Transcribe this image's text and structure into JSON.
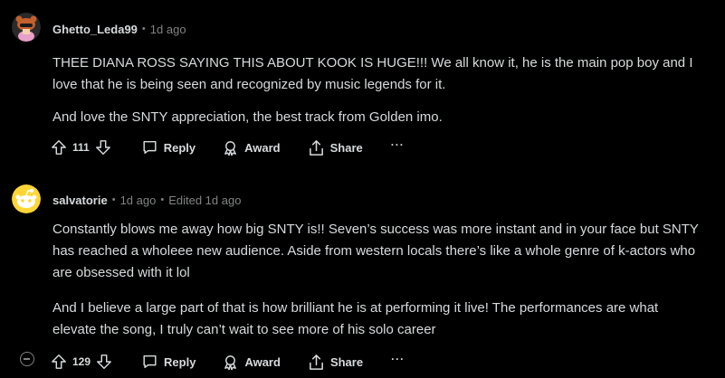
{
  "comments": [
    {
      "author": "Ghetto_Leda99",
      "separator": "•",
      "time": "1d ago",
      "paragraphs": [
        "THEE DIANA ROSS SAYING THIS ABOUT KOOK IS HUGE!!! We all know it, he is the main pop boy and I love that he is being seen and recognized by music legends for it.",
        "And love the SNTY appreciation, the best track from Golden imo."
      ],
      "score": "111",
      "actions": {
        "reply": "Reply",
        "award": "Award",
        "share": "Share",
        "more": "···"
      }
    },
    {
      "author": "salvatorie",
      "separator": "•",
      "time": "1d ago",
      "edited_separator": "•",
      "edited": "Edited 1d ago",
      "paragraphs": [
        "Constantly blows me away how big SNTY is!! Seven’s success was more instant and in your face but SNTY has reached a wholeee new audience. Aside from western locals there’s like a whole genre of k-actors who are obsessed with it lol",
        "And I believe a large part of that is how brilliant he is at performing it live! The performances are what elevate the song, I truly can’t wait to see more of his solo career"
      ],
      "score": "129",
      "actions": {
        "reply": "Reply",
        "award": "Award",
        "share": "Share",
        "more": "···"
      }
    }
  ],
  "colors": {
    "background": "#000000",
    "text": "#d7dadc",
    "meta": "#818384",
    "avatar1": "#c4602b",
    "avatar2": "#ffd635"
  },
  "icons": {
    "upvote": "upvote-icon",
    "downvote": "downvote-icon",
    "reply": "speech-bubble-icon",
    "award": "award-icon",
    "share": "share-icon",
    "collapse": "collapse-minus-icon"
  }
}
